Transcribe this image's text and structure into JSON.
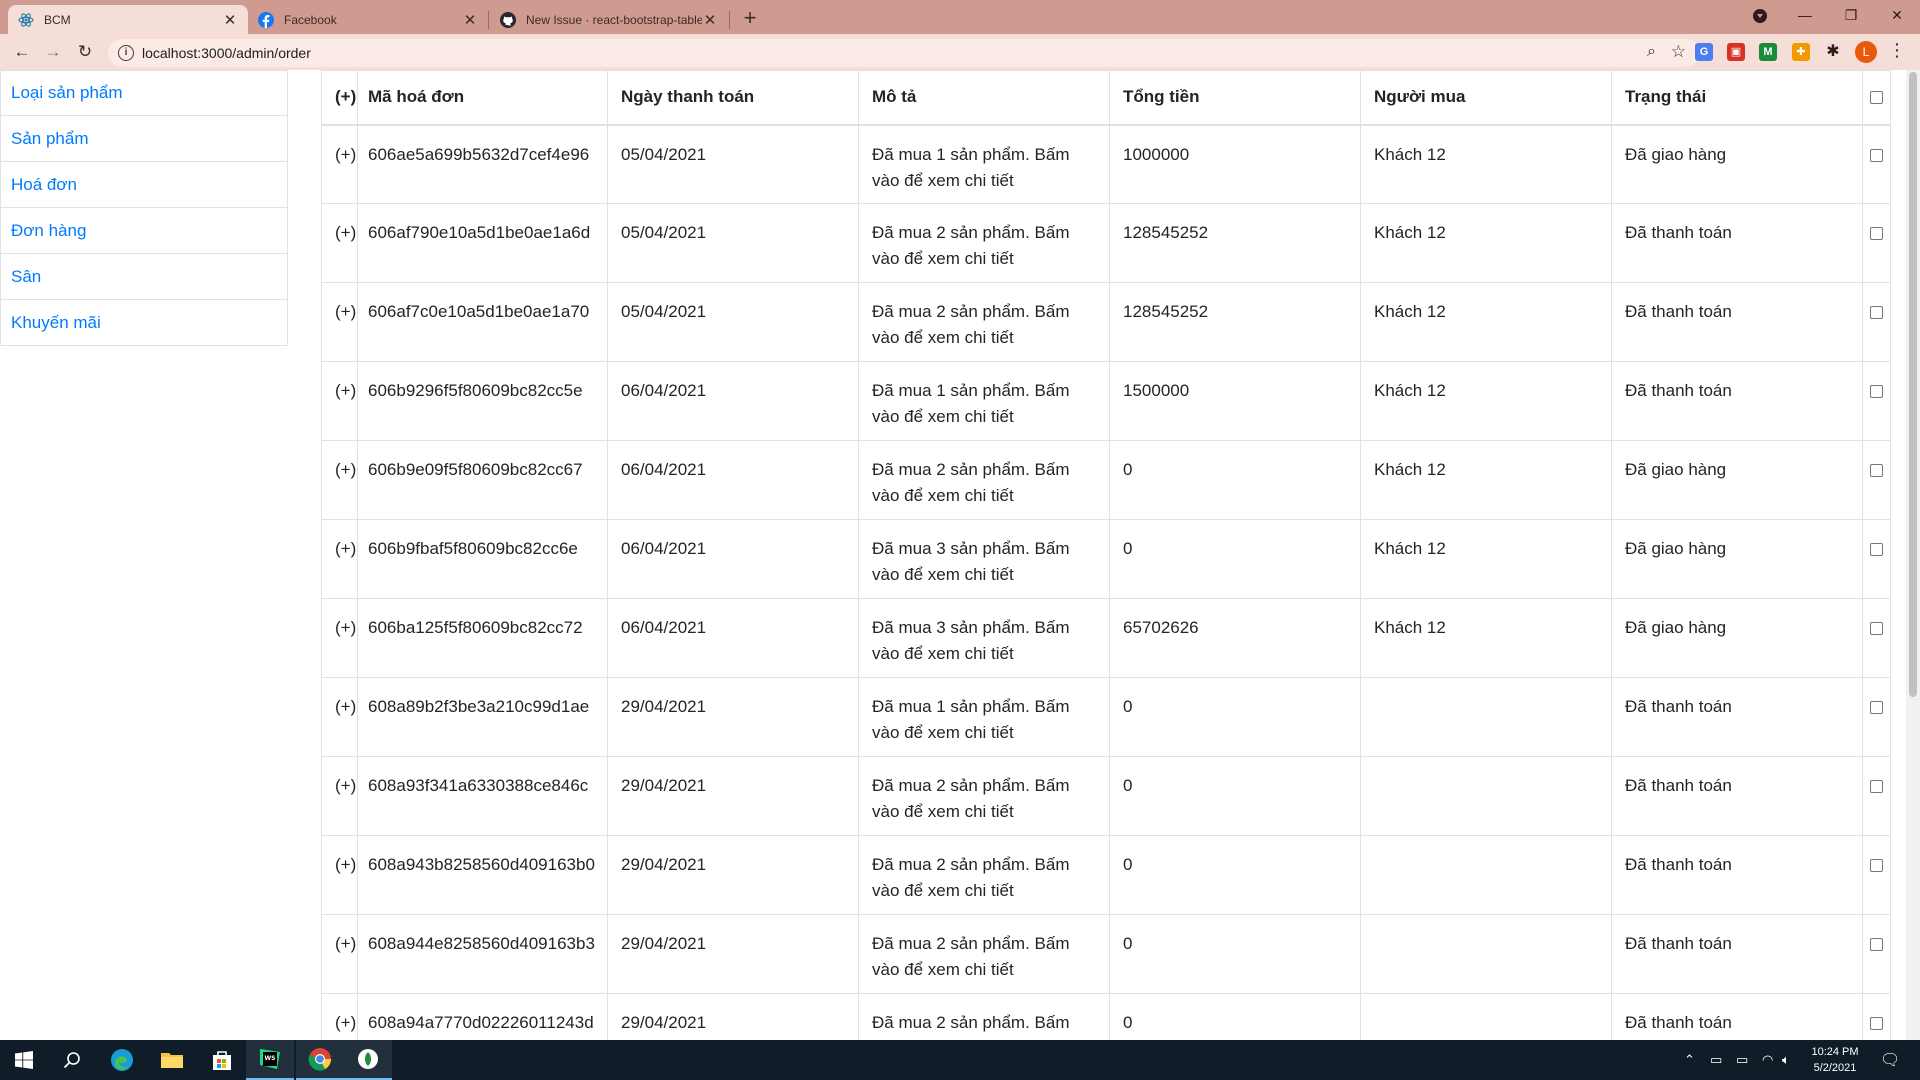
{
  "browser": {
    "tabs": [
      {
        "title": "BCM",
        "active": true,
        "icon": "react-icon"
      },
      {
        "title": "Facebook",
        "active": false,
        "icon": "facebook-icon"
      },
      {
        "title": "New Issue · react-bootstrap-table",
        "active": false,
        "icon": "github-icon"
      }
    ],
    "url": "localhost:3000/admin/order",
    "profile_initial": "L",
    "extensions": [
      {
        "name": "translate-extension-icon",
        "color": "#4c7ef0",
        "glyph": "G"
      },
      {
        "name": "screenshot-extension-icon",
        "color": "#d93025",
        "glyph": "▣"
      },
      {
        "name": "m-extension-icon",
        "color": "#1b8a3a",
        "glyph": "M"
      },
      {
        "name": "color-extension-icon",
        "color": "#f29900",
        "glyph": "✚"
      }
    ]
  },
  "sidebar": {
    "items": [
      {
        "label": "Loại sản phẩm"
      },
      {
        "label": "Sản phẩm"
      },
      {
        "label": "Hoá đơn"
      },
      {
        "label": "Đơn hàng"
      },
      {
        "label": "Sân"
      },
      {
        "label": "Khuyến mãi"
      }
    ]
  },
  "table": {
    "headers": {
      "expand": "(+)",
      "id": "Mã hoá đơn",
      "date": "Ngày thanh toán",
      "desc": "Mô tả",
      "total": "Tổng tiền",
      "buyer": "Người mua",
      "status": "Trạng thái"
    },
    "rows": [
      {
        "expand": "(+)",
        "id": "606ae5a699b5632d7cef4e96",
        "date": "05/04/2021",
        "desc": "Đã mua 1 sản phẩm. Bấm vào để xem chi tiết",
        "total": "1000000",
        "buyer": "Khách 12",
        "status": "Đã giao hàng"
      },
      {
        "expand": "(+)",
        "id": "606af790e10a5d1be0ae1a6d",
        "date": "05/04/2021",
        "desc": "Đã mua 2 sản phẩm. Bấm vào để xem chi tiết",
        "total": "128545252",
        "buyer": "Khách 12",
        "status": "Đã thanh toán"
      },
      {
        "expand": "(+)",
        "id": "606af7c0e10a5d1be0ae1a70",
        "date": "05/04/2021",
        "desc": "Đã mua 2 sản phẩm. Bấm vào để xem chi tiết",
        "total": "128545252",
        "buyer": "Khách 12",
        "status": "Đã thanh toán"
      },
      {
        "expand": "(+)",
        "id": "606b9296f5f80609bc82cc5e",
        "date": "06/04/2021",
        "desc": "Đã mua 1 sản phẩm. Bấm vào để xem chi tiết",
        "total": "1500000",
        "buyer": "Khách 12",
        "status": "Đã thanh toán"
      },
      {
        "expand": "(+)",
        "id": "606b9e09f5f80609bc82cc67",
        "date": "06/04/2021",
        "desc": "Đã mua 2 sản phẩm. Bấm vào để xem chi tiết",
        "total": "0",
        "buyer": "Khách 12",
        "status": "Đã giao hàng"
      },
      {
        "expand": "(+)",
        "id": "606b9fbaf5f80609bc82cc6e",
        "date": "06/04/2021",
        "desc": "Đã mua 3 sản phẩm. Bấm vào để xem chi tiết",
        "total": "0",
        "buyer": "Khách 12",
        "status": "Đã giao hàng"
      },
      {
        "expand": "(+)",
        "id": "606ba125f5f80609bc82cc72",
        "date": "06/04/2021",
        "desc": "Đã mua 3 sản phẩm. Bấm vào để xem chi tiết",
        "total": "65702626",
        "buyer": "Khách 12",
        "status": "Đã giao hàng"
      },
      {
        "expand": "(+)",
        "id": "608a89b2f3be3a210c99d1ae",
        "date": "29/04/2021",
        "desc": "Đã mua 1 sản phẩm. Bấm vào để xem chi tiết",
        "total": "0",
        "buyer": "",
        "status": "Đã thanh toán"
      },
      {
        "expand": "(+)",
        "id": "608a93f341a6330388ce846c",
        "date": "29/04/2021",
        "desc": "Đã mua 2 sản phẩm. Bấm vào để xem chi tiết",
        "total": "0",
        "buyer": "",
        "status": "Đã thanh toán"
      },
      {
        "expand": "(+)",
        "id": "608a943b8258560d409163b0",
        "date": "29/04/2021",
        "desc": "Đã mua 2 sản phẩm. Bấm vào để xem chi tiết",
        "total": "0",
        "buyer": "",
        "status": "Đã thanh toán"
      },
      {
        "expand": "(+)",
        "id": "608a944e8258560d409163b3",
        "date": "29/04/2021",
        "desc": "Đã mua 2 sản phẩm. Bấm vào để xem chi tiết",
        "total": "0",
        "buyer": "",
        "status": "Đã thanh toán"
      },
      {
        "expand": "(+)",
        "id": "608a94a7770d02226011243d",
        "date": "29/04/2021",
        "desc": "Đã mua 2 sản phẩm. Bấm",
        "total": "0",
        "buyer": "",
        "status": "Đã thanh toán"
      }
    ]
  },
  "taskbar": {
    "apps": [
      {
        "name": "search-taskbar-icon",
        "running": false
      },
      {
        "name": "edge-taskbar-icon",
        "running": false
      },
      {
        "name": "file-explorer-taskbar-icon",
        "running": false
      },
      {
        "name": "store-taskbar-icon",
        "running": false
      },
      {
        "name": "webstorm-taskbar-icon",
        "running": true
      },
      {
        "name": "chrome-taskbar-icon",
        "running": true
      },
      {
        "name": "node-taskbar-icon",
        "running": true
      }
    ],
    "time": "10:24 PM",
    "date": "5/2/2021"
  }
}
